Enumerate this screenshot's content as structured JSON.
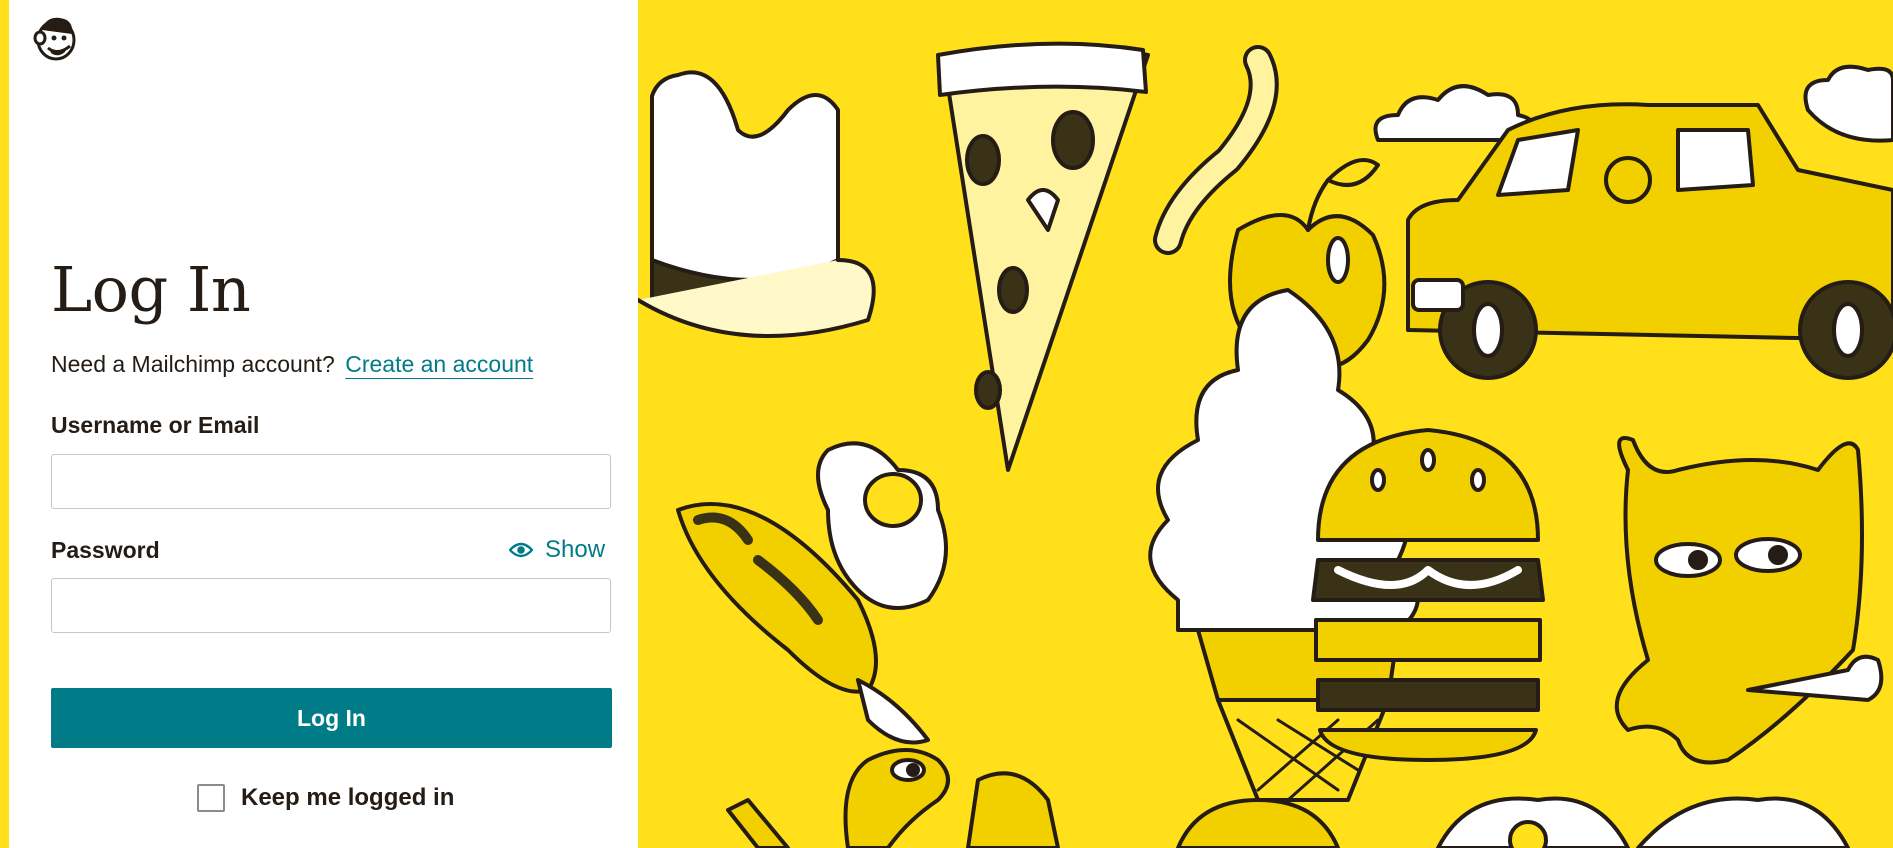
{
  "brand": {
    "logo_icon": "mailchimp-freddie-logo-icon",
    "accent": "#007c89",
    "art_background": "#ffe01b",
    "text_color": "#241c15"
  },
  "login": {
    "title": "Log In",
    "signup_prompt": "Need a Mailchimp account?",
    "signup_link": "Create an account",
    "username_label": "Username or Email",
    "username_value": "",
    "password_label": "Password",
    "password_value": "",
    "show_label": "Show",
    "show_icon": "eye-icon",
    "submit_label": "Log In",
    "keep_logged_in_label": "Keep me logged in",
    "keep_logged_in_checked": false
  },
  "illustration": {
    "items": [
      "hat-icon",
      "pizza-slice-icon",
      "worm-icon",
      "apple-icon",
      "cloud-icon",
      "truck-icon",
      "ice-cream-cone-icon",
      "hamburger-icon",
      "wolf-icon",
      "fish-icon",
      "fried-egg-icon",
      "bone-icon",
      "snake-icon",
      "donut-icon"
    ]
  }
}
